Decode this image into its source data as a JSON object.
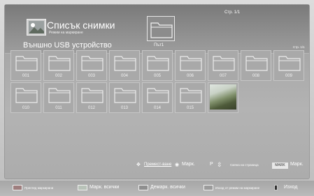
{
  "header": {
    "title": "Списък снимки",
    "mode": "Режим на маркиране",
    "device": "Външно USB устройство",
    "path": "Път1",
    "page_top": "Стр. 1/1",
    "page_right": "Стр. 1/1"
  },
  "grid": {
    "tiles": [
      {
        "label": "001",
        "type": "folder"
      },
      {
        "label": "002",
        "type": "folder"
      },
      {
        "label": "003",
        "type": "folder"
      },
      {
        "label": "004",
        "type": "folder"
      },
      {
        "label": "005",
        "type": "folder"
      },
      {
        "label": "006",
        "type": "folder"
      },
      {
        "label": "007",
        "type": "folder"
      },
      {
        "label": "008",
        "type": "folder"
      },
      {
        "label": "009",
        "type": "folder"
      },
      {
        "label": "010",
        "type": "folder"
      },
      {
        "label": "011",
        "type": "folder"
      },
      {
        "label": "012",
        "type": "folder"
      },
      {
        "label": "013",
        "type": "folder"
      },
      {
        "label": "014",
        "type": "folder"
      },
      {
        "label": "015",
        "type": "folder"
      },
      {
        "label": "",
        "type": "photo"
      }
    ]
  },
  "hints": {
    "move": "Премест-ване",
    "mark": "Марк.",
    "page_prefix": "P",
    "page_change": "Смяна на страница",
    "mark_key": "MARK",
    "mark2": "Марк."
  },
  "footer": {
    "red": "Преглед маркирани",
    "green": "Марк. всички",
    "yellow": "Демарк. всички",
    "blue": "Изход от режим на маркиране",
    "exit": "Изход"
  },
  "colors": {
    "red": "#9e7e7e",
    "green": "#b8c2b8",
    "yellow": "#8f8f8f",
    "blue": "#9b9b9b"
  }
}
